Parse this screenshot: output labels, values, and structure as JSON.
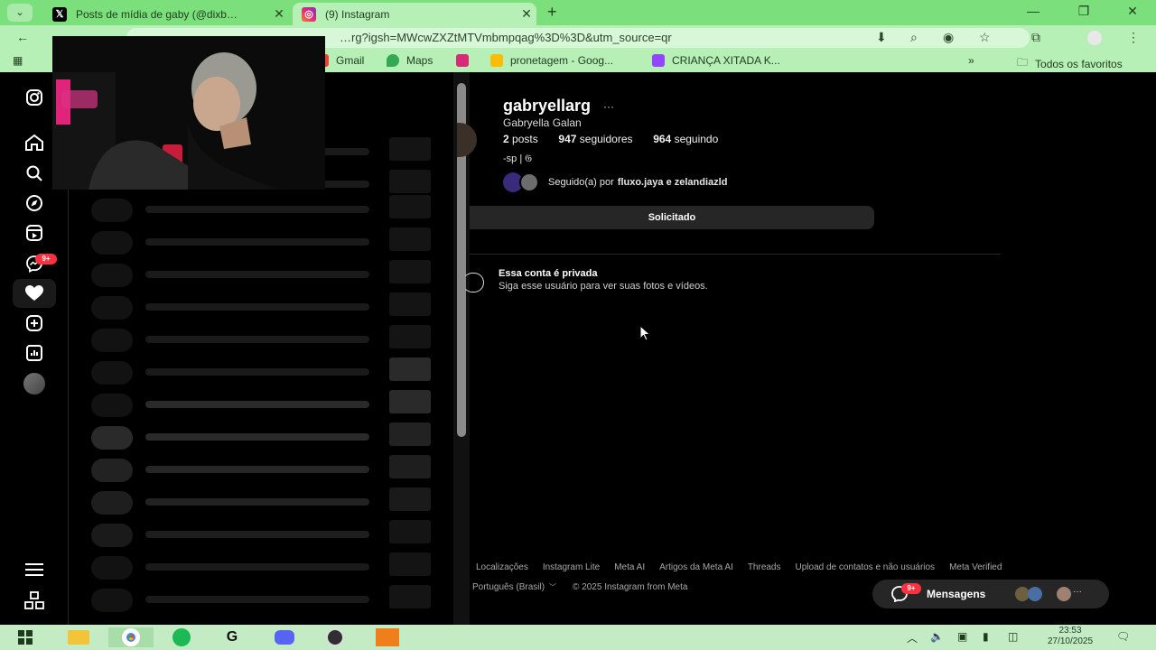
{
  "browser": {
    "tabs": [
      {
        "title": "Posts de mídia de gaby (@dixb…",
        "favicon": "x-logo"
      },
      {
        "title": "(9) Instagram",
        "favicon": "instagram-logo"
      }
    ],
    "address_url": "…rg?igsh=MWcwZXZtMTVmbmpqag%3D%3D&utm_source=qr",
    "bookmarks": [
      {
        "label": "Gmail",
        "color": "#ea4335"
      },
      {
        "label": "Maps",
        "color": "#34a853"
      },
      {
        "label": "",
        "color": "#d62976"
      },
      {
        "label": "pronetagem - Goog...",
        "color": "#fbbc04"
      },
      {
        "label": "CRIANÇA XITADA K...",
        "color": "#9146ff"
      }
    ],
    "bookmarks_more": "»",
    "all_bookmarks": "Todos os favoritos"
  },
  "profile": {
    "username": "gabryellarg",
    "more": "···",
    "full_name": "Gabryella Galan",
    "posts_count": "2",
    "posts_label": "posts",
    "followers_count": "947",
    "followers_label": "seguidores",
    "following_count": "964",
    "following_label": "seguindo",
    "bio": "-sp | 𝔊",
    "followed_by_prefix": "Seguido(a) por",
    "followed_by_names": "fluxo.jaya e zelandiazld",
    "follow_button": "Solicitado",
    "private_title": "Essa conta é privada",
    "private_subtitle": "Siga esse usuário para ver suas fotos e vídeos."
  },
  "footer": {
    "links": [
      "Localizações",
      "Instagram Lite",
      "Meta AI",
      "Artigos da Meta AI",
      "Threads",
      "Upload de contatos e não usuários",
      "Meta Verified"
    ],
    "language": "Português (Brasil)",
    "copyright": "© 2025 Instagram from Meta"
  },
  "nav": {
    "notif_badge": "9+"
  },
  "messages": {
    "label": "Mensagens",
    "badge": "9+",
    "more": "···"
  },
  "taskbar": {
    "time": "23:53",
    "date": "27/10/2025"
  },
  "colors": {
    "browser_frame": "#7be07b",
    "toolbar": "#b7f0b7",
    "ig_background": "#000000",
    "button": "#262626"
  }
}
